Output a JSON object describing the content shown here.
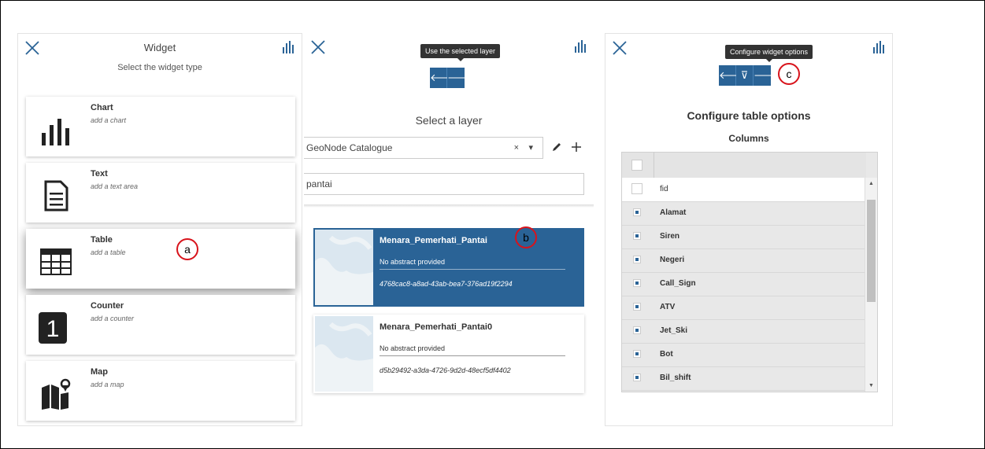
{
  "panel1": {
    "title": "Widget",
    "subtitle": "Select the widget type",
    "cards": [
      {
        "title": "Chart",
        "desc": "add a chart",
        "icon": "bar-chart-icon"
      },
      {
        "title": "Text",
        "desc": "add a text area",
        "icon": "document-icon"
      },
      {
        "title": "Table",
        "desc": "add a table",
        "icon": "table-icon"
      },
      {
        "title": "Counter",
        "desc": "add a counter",
        "icon": "counter-icon",
        "icon_text": "1"
      },
      {
        "title": "Map",
        "desc": "add a map",
        "icon": "map-icon"
      }
    ],
    "callout": "a"
  },
  "panel2": {
    "tooltip": "Use the selected layer",
    "title": "Select a layer",
    "catalogue": "GeoNode Catalogue",
    "clear_glyph": "×",
    "caret_glyph": "▾",
    "search_value": "pantai",
    "layers": [
      {
        "name": "Menara_Pemerhati_Pantai",
        "abstract": "No abstract provided",
        "id": "4768cac8-a8ad-43ab-bea7-376ad19f2294"
      },
      {
        "name": "Menara_Pemerhati_Pantai0",
        "abstract": "No abstract provided",
        "id": "d5b29492-a3da-4726-9d2d-48ecf5df4402"
      }
    ],
    "callout": "b"
  },
  "panel3": {
    "tooltip": "Configure widget options",
    "title": "Configure table options",
    "subtitle": "Columns",
    "columns": [
      {
        "name": "fid",
        "checked": false
      },
      {
        "name": "Alamat",
        "checked": true
      },
      {
        "name": "Siren",
        "checked": true
      },
      {
        "name": "Negeri",
        "checked": true
      },
      {
        "name": "Call_Sign",
        "checked": true
      },
      {
        "name": "ATV",
        "checked": true
      },
      {
        "name": "Jet_Ski",
        "checked": true
      },
      {
        "name": "Bot",
        "checked": true
      },
      {
        "name": "Bil_shift",
        "checked": true
      }
    ],
    "callout": "c"
  },
  "colors": {
    "accent": "#2a6396",
    "callout": "#d8131b"
  }
}
